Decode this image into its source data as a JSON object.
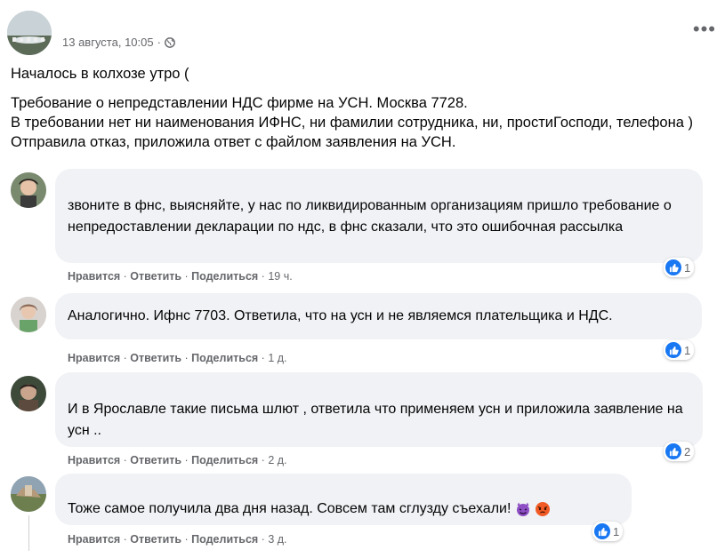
{
  "post": {
    "timestamp": "13 августа, 10:05",
    "separator": "·",
    "paragraphs": [
      "Началось в колхозе утро (",
      "Требование о непредставлении НДС фирме на УСН. Москва 7728.",
      "В требовании нет ни наименования ИФНС, ни фамилии сотрудника, ни, простиГосподи, телефона ) Отправила отказ, приложила ответ с файлом заявления на УСН."
    ],
    "more_label": "•••"
  },
  "actions": {
    "like": "Нравится",
    "reply": "Ответить",
    "share": "Поделиться",
    "sep": " · "
  },
  "comments": [
    {
      "text": "звоните в фнс, выясняйте, у нас по ликвидированным организациям пришло требование о непредоставлении декларации по ндс, в фнс сказали, что это ошибочная рассылка",
      "time": "19 ч.",
      "reactions": "1"
    },
    {
      "text": "Аналогично. Ифнс 7703. Ответила, что на усн и не являемся плательщика и НДС.",
      "time": "1 д.",
      "reactions": "1"
    },
    {
      "text": "И в Ярославле такие письма шлют , ответила что применяем усн и приложила заявление на усн ..",
      "time": "2 д.",
      "reactions": "2"
    },
    {
      "text": "Тоже самое получила два дня назад. Совсем там сглузду съехали!",
      "time": "3 д.",
      "reactions": "1"
    }
  ],
  "colors": {
    "accent": "#1877f2",
    "bubble": "#f0f2f5",
    "muted": "#65676b"
  }
}
